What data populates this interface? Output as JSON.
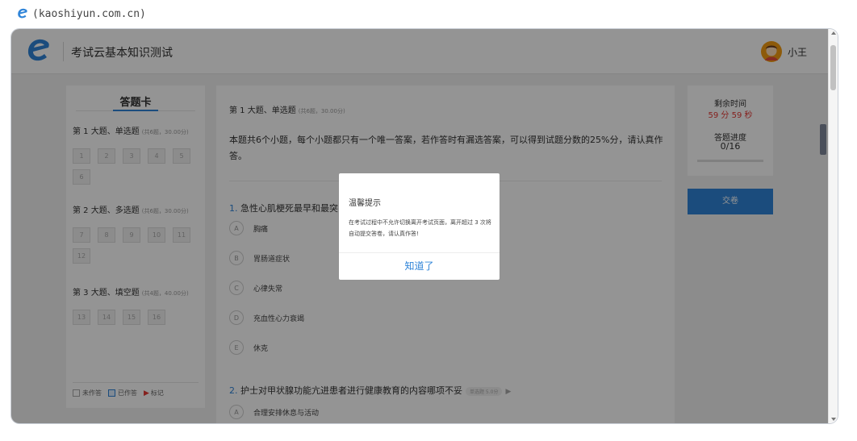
{
  "source_caption": "(kaoshiyun.com.cn)",
  "colors": {
    "brand": "#2f84d8",
    "time_red": "#e53935",
    "overlay": "rgba(0,0,0,0.42)"
  },
  "header": {
    "logo_icon": "e-logo-icon",
    "title": "考试云基本知识测试",
    "user_name": "小王",
    "avatar_icon": "avatar-icon"
  },
  "answer_card": {
    "title": "答题卡",
    "sections": [
      {
        "title": "第 1 大题、单选题",
        "meta": "(共6题，30.00分)",
        "numbers": [
          "1",
          "2",
          "3",
          "4",
          "5",
          "6"
        ]
      },
      {
        "title": "第 2 大题、多选题",
        "meta": "(共6题，30.00分)",
        "numbers": [
          "7",
          "8",
          "9",
          "10",
          "11",
          "12"
        ]
      },
      {
        "title": "第 3 大题、填空题",
        "meta": "(共4题，40.00分)",
        "numbers": [
          "13",
          "14",
          "15",
          "16"
        ]
      }
    ],
    "legend": {
      "undone": "未作答",
      "done": "已作答",
      "flagged": "标记"
    }
  },
  "main": {
    "section_head": "第 1 大题、单选题",
    "section_meta": "(共6题，30.00分)",
    "intro": "本题共6个小题，每个小题都只有一个唯一答案，若作答时有漏选答案，可以得到试题分数的25%分，请认真作答。",
    "q1": {
      "no": "1.",
      "text": "急性心肌梗死最早和最突出",
      "options": [
        {
          "letter": "A",
          "text": "胸痛"
        },
        {
          "letter": "B",
          "text": "胃肠道症状"
        },
        {
          "letter": "C",
          "text": "心律失常"
        },
        {
          "letter": "D",
          "text": "充血性心力衰竭"
        },
        {
          "letter": "E",
          "text": "休克"
        }
      ]
    },
    "q2": {
      "no": "2.",
      "text": "护士对甲状腺功能亢进患者进行健康教育的内容哪项不妥",
      "badge": "单选题 5.0分",
      "option_a_letter": "A",
      "option_a_text": "合理安排休息与活动"
    }
  },
  "status": {
    "time_label": "剩余时间",
    "time_value": "59 分 59 秒",
    "progress_label": "答题进度",
    "progress_value": "0/16",
    "progress_fraction": 0
  },
  "submit_label": "交卷",
  "modal": {
    "title": "温馨提示",
    "body": "在考试过程中不允许切换离开考试页面，离开超过 3 次将自动提交答卷，请认真作答!",
    "confirm": "知道了"
  }
}
